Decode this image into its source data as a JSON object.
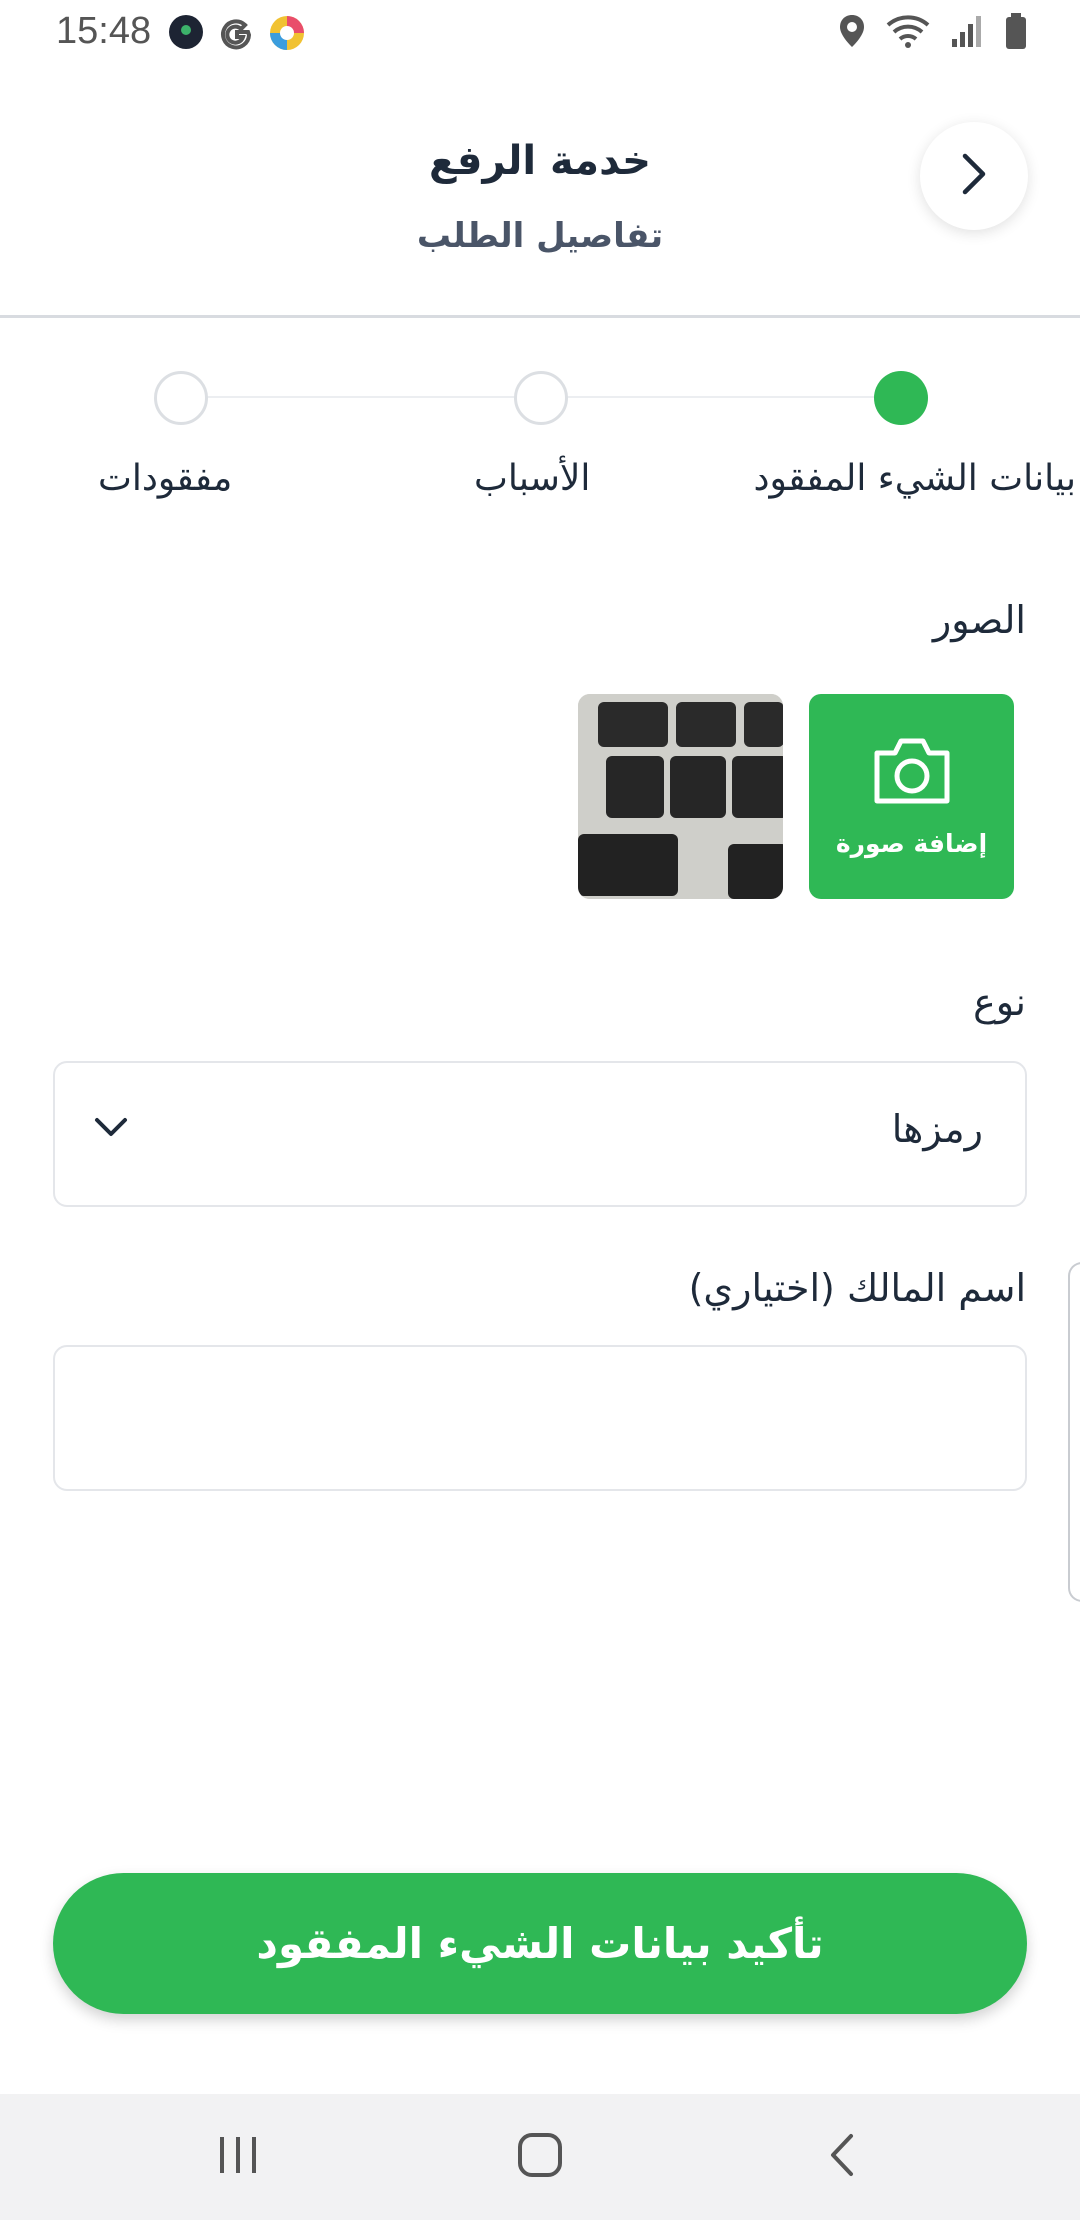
{
  "status_bar": {
    "time": "15:48",
    "left_icons": [
      "app-notification-icon",
      "google-icon",
      "chrome-like-icon"
    ],
    "right_icons": [
      "location-icon",
      "wifi-icon",
      "signal-icon",
      "battery-icon"
    ]
  },
  "header": {
    "title": "خدمة الرفع",
    "subtitle": "تفاصيل الطلب",
    "back_icon": "chevron-right-icon"
  },
  "stepper": {
    "steps": [
      {
        "label": "بيانات الشيء المفقود",
        "state": "active"
      },
      {
        "label": "الأسباب",
        "state": "inactive"
      },
      {
        "label": "مفقودات",
        "state": "inactive"
      }
    ]
  },
  "photos": {
    "label": "الصور",
    "add_label": "إضافة صورة",
    "add_icon": "camera-icon"
  },
  "type_field": {
    "label": "نوع",
    "value": "رمزها",
    "icon": "chevron-down-icon"
  },
  "owner_field": {
    "label": "اسم المالك (اختياري)",
    "value": ""
  },
  "confirm_button": {
    "label": "تأكيد بيانات الشيء المفقود"
  },
  "nav_bar": {
    "icons": [
      "recent-apps-icon",
      "home-icon",
      "back-icon"
    ]
  },
  "colors": {
    "accent": "#2fb855",
    "text": "#1e2a3a",
    "border": "#e4e6ea"
  }
}
